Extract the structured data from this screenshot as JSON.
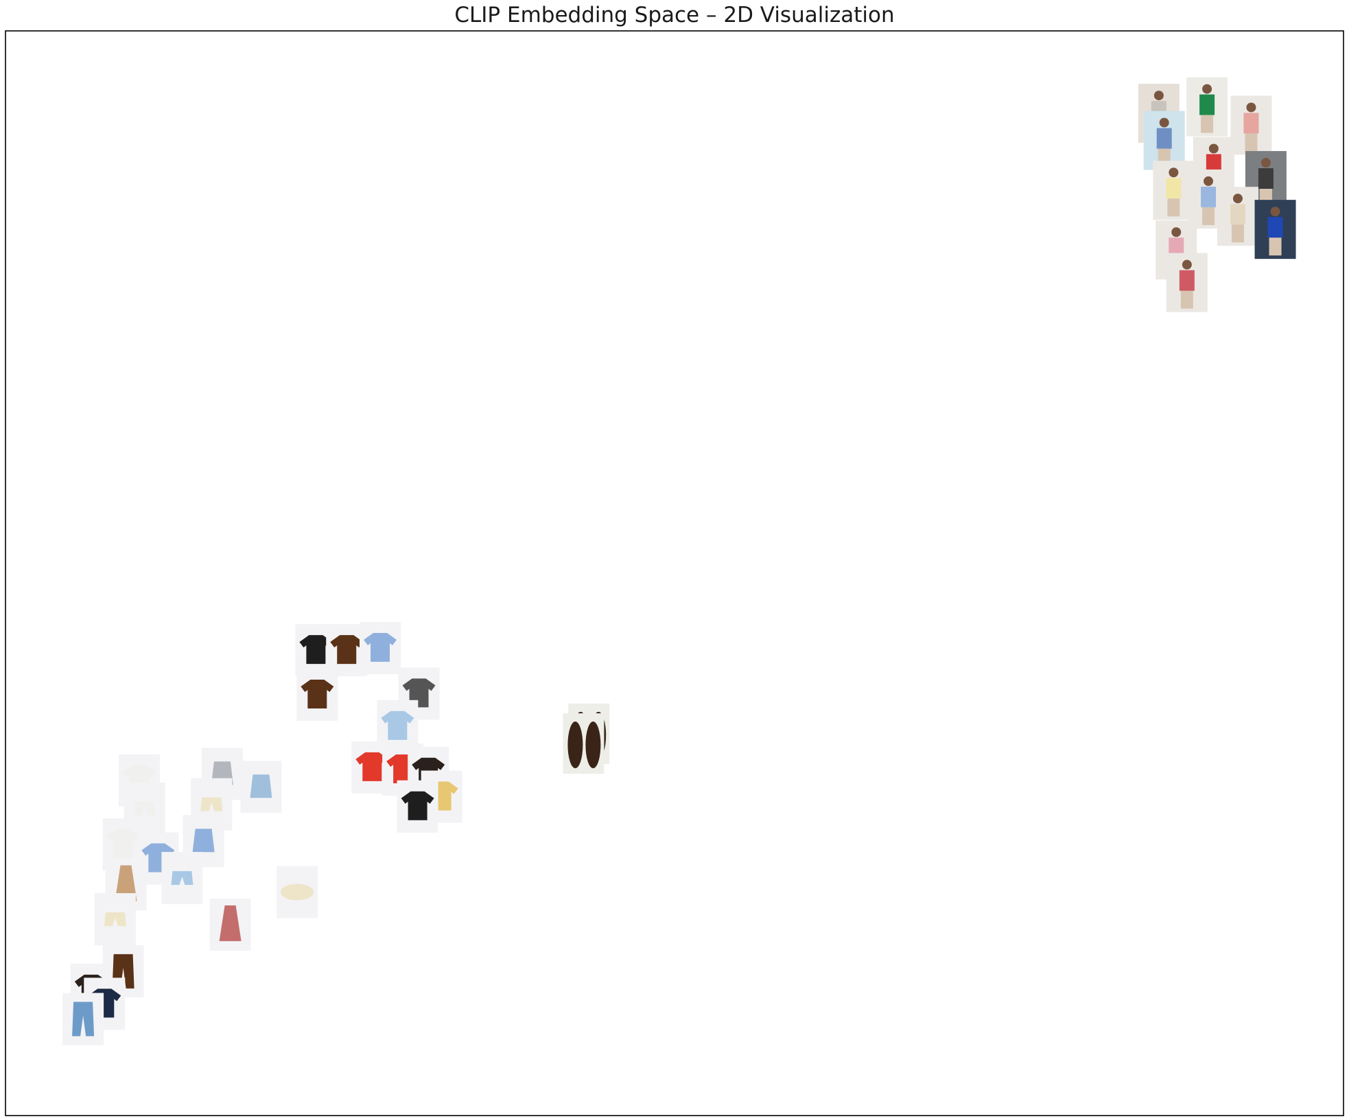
{
  "chart_data": {
    "type": "scatter",
    "title": "CLIP Embedding Space – 2D Visualization",
    "xlabel": "",
    "ylabel": "",
    "axes_visible": false,
    "grid": false,
    "marker_style": "image thumbnails",
    "xlim": [
      0,
      100
    ],
    "ylim": [
      0,
      100
    ],
    "clusters": [
      {
        "name": "",
        "points": [
          {
            "x": 86.2,
            "y": 92.4,
            "item": "photo-model"
          },
          {
            "x": 89.8,
            "y": 93.0,
            "item": "photo-green-dress"
          },
          {
            "x": 93.1,
            "y": 91.3,
            "item": "photo-floral-dress"
          },
          {
            "x": 86.6,
            "y": 89.9,
            "item": "photo-beach"
          },
          {
            "x": 90.3,
            "y": 87.5,
            "item": "photo-red-top"
          },
          {
            "x": 94.2,
            "y": 86.2,
            "item": "photo-street"
          },
          {
            "x": 87.3,
            "y": 85.3,
            "item": "photo-yellow-top"
          },
          {
            "x": 89.9,
            "y": 84.5,
            "item": "photo-blue-shirt"
          },
          {
            "x": 92.1,
            "y": 82.9,
            "item": "photo-cream-outfit"
          },
          {
            "x": 94.9,
            "y": 81.7,
            "item": "photo-blue-jacket"
          },
          {
            "x": 87.5,
            "y": 79.8,
            "item": "photo-pink-top"
          },
          {
            "x": 88.3,
            "y": 76.8,
            "item": "photo-gingham-top"
          }
        ]
      },
      {
        "name": "",
        "points": [
          {
            "x": 43.6,
            "y": 35.2,
            "item": "shoes-brown-loafers"
          },
          {
            "x": 43.2,
            "y": 34.3,
            "item": "shoes-brown-loafers"
          }
        ]
      },
      {
        "name": "",
        "points": [
          {
            "x": 23.2,
            "y": 42.9,
            "item": "black-tshirt"
          },
          {
            "x": 25.5,
            "y": 42.9,
            "item": "brown-shirt"
          },
          {
            "x": 28.0,
            "y": 43.1,
            "item": "blue-shirt"
          },
          {
            "x": 23.3,
            "y": 38.8,
            "item": "brown-blouse"
          },
          {
            "x": 30.9,
            "y": 38.9,
            "item": "striped-top"
          },
          {
            "x": 29.3,
            "y": 35.9,
            "item": "light-blue-sweater"
          },
          {
            "x": 27.4,
            "y": 32.1,
            "item": "red-cardigan"
          },
          {
            "x": 29.7,
            "y": 31.9,
            "item": "red-top"
          },
          {
            "x": 31.6,
            "y": 31.6,
            "item": "dark-cardigan"
          },
          {
            "x": 32.6,
            "y": 29.4,
            "item": "yellow-top"
          },
          {
            "x": 30.8,
            "y": 28.5,
            "item": "black-cardigan"
          }
        ]
      },
      {
        "name": "",
        "points": [
          {
            "x": 16.2,
            "y": 31.5,
            "item": "grey-camisole"
          },
          {
            "x": 19.1,
            "y": 30.3,
            "item": "denim-vest"
          },
          {
            "x": 15.4,
            "y": 28.7,
            "item": "cream-shorts"
          },
          {
            "x": 10.0,
            "y": 30.9,
            "item": "white-item"
          },
          {
            "x": 10.4,
            "y": 28.3,
            "item": "white-shorts"
          },
          {
            "x": 8.8,
            "y": 25.0,
            "item": "white-top"
          },
          {
            "x": 14.8,
            "y": 25.3,
            "item": "blue-halter-top"
          },
          {
            "x": 11.4,
            "y": 23.7,
            "item": "blue-item"
          },
          {
            "x": 13.2,
            "y": 21.9,
            "item": "light-blue-shorts"
          },
          {
            "x": 9.0,
            "y": 21.3,
            "item": "tan-skirt"
          },
          {
            "x": 8.2,
            "y": 18.1,
            "item": "cream-shorts"
          },
          {
            "x": 16.8,
            "y": 17.6,
            "item": "gingham-dress"
          },
          {
            "x": 21.8,
            "y": 20.6,
            "item": "cream-bucket-hat"
          },
          {
            "x": 8.8,
            "y": 13.3,
            "item": "brown-trousers"
          },
          {
            "x": 6.4,
            "y": 11.6,
            "item": "dark-item"
          },
          {
            "x": 7.4,
            "y": 10.3,
            "item": "navy-item"
          },
          {
            "x": 5.8,
            "y": 8.9,
            "item": "blue-jeans"
          }
        ]
      }
    ]
  }
}
